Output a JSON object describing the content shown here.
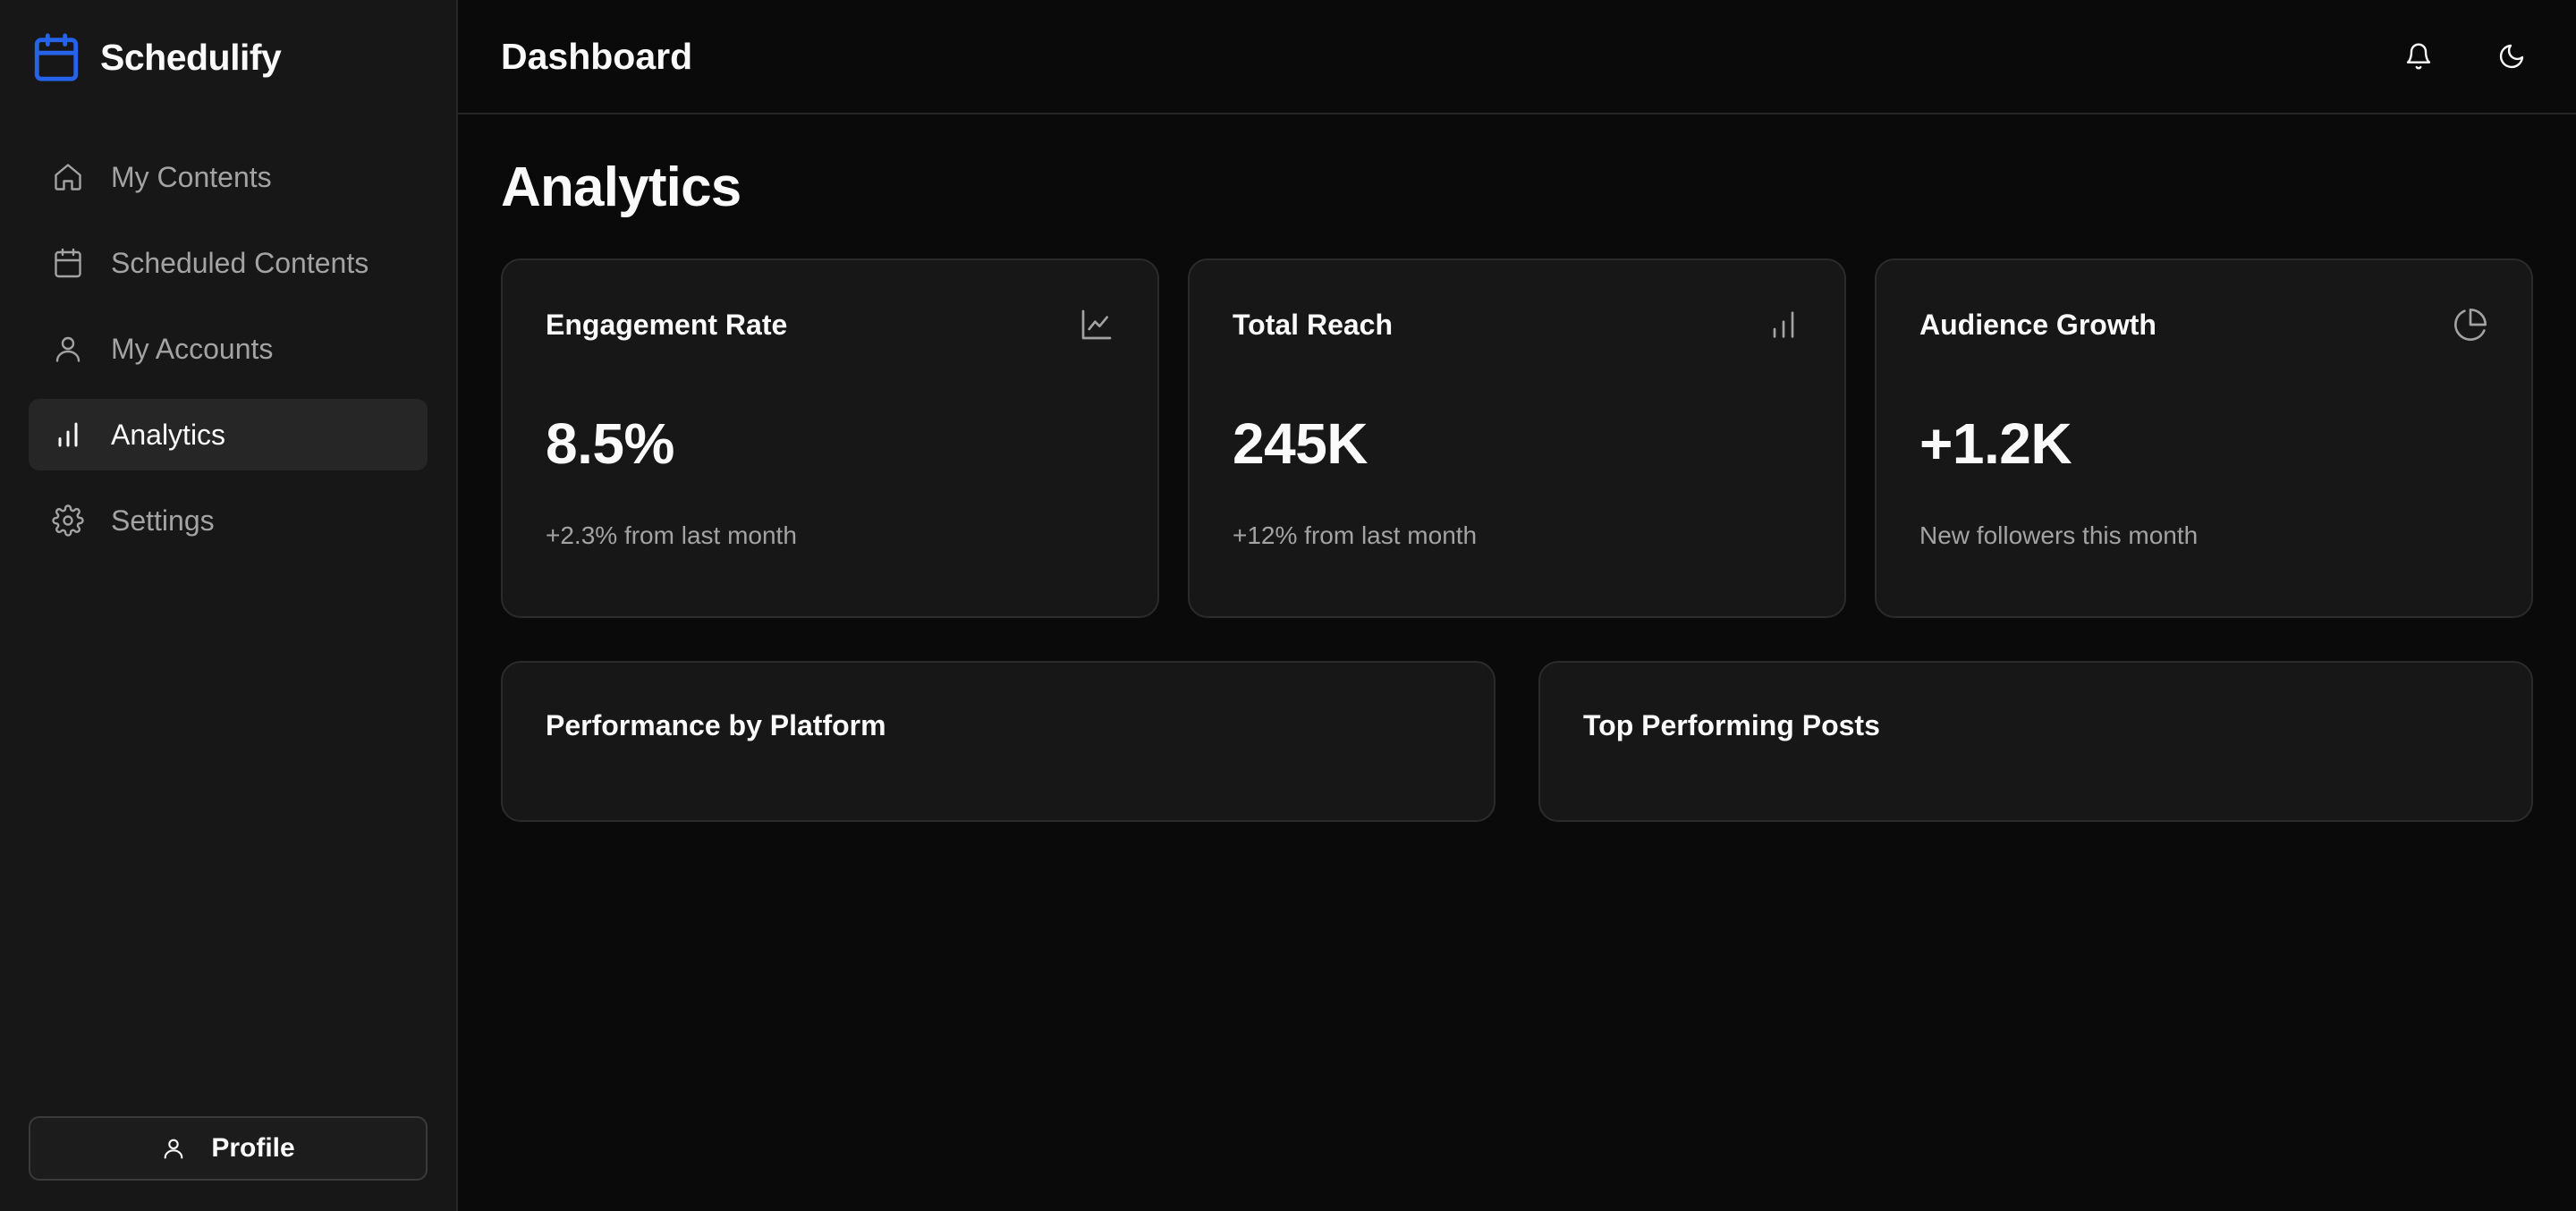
{
  "brand": {
    "name": "Schedulify",
    "accent": "#2563eb"
  },
  "sidebar": {
    "items": [
      {
        "label": "My Contents",
        "icon": "home-icon",
        "active": false
      },
      {
        "label": "Scheduled Contents",
        "icon": "calendar-icon",
        "active": false
      },
      {
        "label": "My Accounts",
        "icon": "user-icon",
        "active": false
      },
      {
        "label": "Analytics",
        "icon": "bar-chart-icon",
        "active": true
      },
      {
        "label": "Settings",
        "icon": "gear-icon",
        "active": false
      }
    ],
    "profile_label": "Profile"
  },
  "header": {
    "title": "Dashboard",
    "actions": [
      "bell-icon",
      "moon-icon"
    ]
  },
  "main": {
    "page_title": "Analytics",
    "stats": [
      {
        "label": "Engagement Rate",
        "value": "8.5%",
        "sub": "+2.3% from last month",
        "icon": "line-chart-icon"
      },
      {
        "label": "Total Reach",
        "value": "245K",
        "sub": "+12% from last month",
        "icon": "bar-chart-icon"
      },
      {
        "label": "Audience Growth",
        "value": "+1.2K",
        "sub": "New followers this month",
        "icon": "pie-chart-icon"
      }
    ],
    "panels": [
      {
        "title": "Performance by Platform"
      },
      {
        "title": "Top Performing Posts"
      }
    ]
  },
  "colors": {
    "background": "#0a0a0a",
    "sidebar": "#171717",
    "card": "#171717",
    "muted_text": "#a3a3a3"
  }
}
